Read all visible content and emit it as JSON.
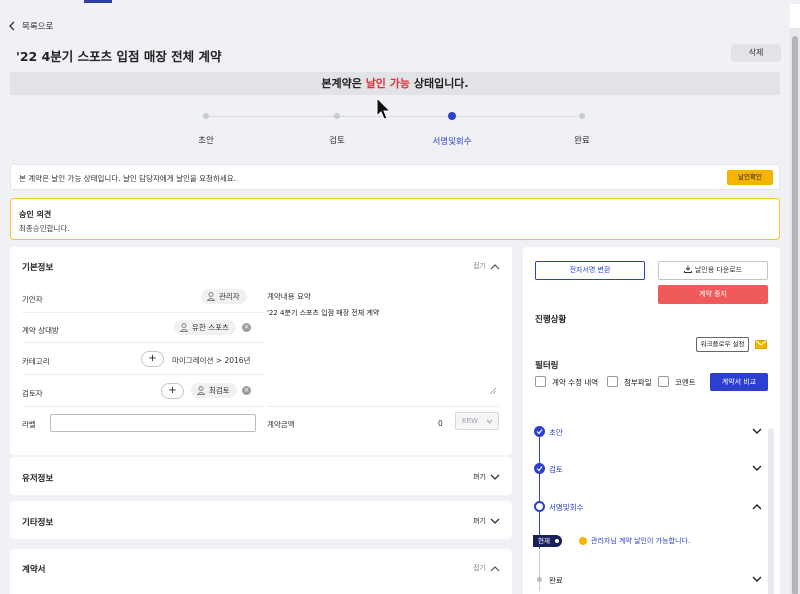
{
  "back_label": "목록으로",
  "title": "'22 4분기 스포츠 입점 매장 전체 계약",
  "delete_label": "삭제",
  "banner": {
    "prefix": "본계약은 ",
    "highlight": "날인 가능",
    "suffix": " 상태입니다."
  },
  "steps": [
    {
      "label": "초안",
      "active": false
    },
    {
      "label": "검토",
      "active": false
    },
    {
      "label": "서명및회수",
      "active": true
    },
    {
      "label": "완료",
      "active": false
    }
  ],
  "notice": {
    "text": "본 계약은 날인 가능 상태입니다. 날인 담당자에게 날인을 요청하세요.",
    "button": "날인확인"
  },
  "opinion": {
    "heading": "승인 의견",
    "body": "최종승인합니다."
  },
  "basic": {
    "heading": "기본정보",
    "fold": "접기",
    "drafter_label": "기안자",
    "drafter_value": "관리자",
    "party_label": "계약 상대방",
    "party_value": "유한 스포츠",
    "category_label": "카테고리",
    "category_value": "마이그레이션 > 2016년",
    "reviewer_label": "검토자",
    "reviewer_value": "최검토",
    "label_label": "라벨",
    "summary_label": "계약내용 요약",
    "summary_value": "'22 4분기 스포츠 입점 매장 전체 계약",
    "amount_label": "계약금액",
    "amount_value": "0",
    "currency": "KRW"
  },
  "sections": [
    {
      "heading": "유저정보",
      "fold": "펴기"
    },
    {
      "heading": "기타정보",
      "fold": "펴기"
    }
  ],
  "contract": {
    "heading": "계약서",
    "fold": "접기"
  },
  "right": {
    "esign_button": "전자서명 변환",
    "download_button": "날인용 다운로드",
    "stop_button": "계약 중지",
    "progress_heading": "진행상황",
    "workflow_button": "워크플로우 설정",
    "filter_heading": "필터링",
    "filters": [
      "계약 수정 내역",
      "첨부파일",
      "코멘트"
    ],
    "compare_button": "계약서 비교",
    "timeline": [
      {
        "label": "초안",
        "state": "done"
      },
      {
        "label": "검토",
        "state": "done"
      },
      {
        "label": "서명및회수",
        "state": "current"
      },
      {
        "label": "완료",
        "state": "todo"
      }
    ],
    "current_badge": "현재",
    "current_message": "관리자님 계약 날인이 가능합니다."
  },
  "colors": {
    "accent": "#2d3fd0",
    "danger": "#f05a5a",
    "warning": "#f5b400",
    "highlight": "#e0313d"
  }
}
